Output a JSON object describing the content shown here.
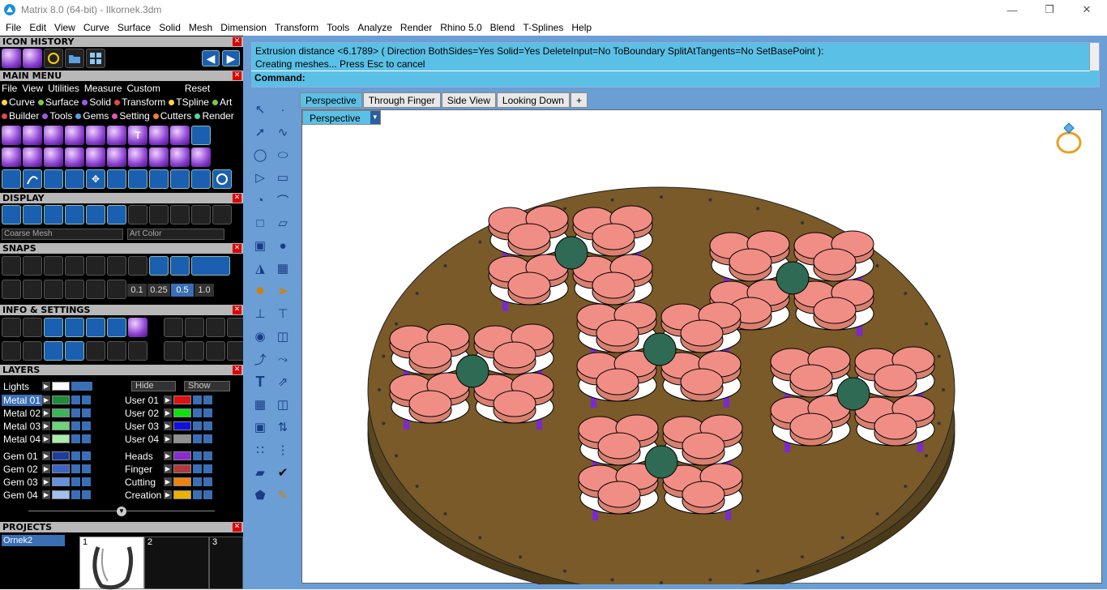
{
  "window": {
    "title": "Matrix 8.0 (64-bit) - Ilkornek.3dm"
  },
  "menu": [
    "File",
    "Edit",
    "View",
    "Curve",
    "Surface",
    "Solid",
    "Mesh",
    "Dimension",
    "Transform",
    "Tools",
    "Analyze",
    "Render",
    "Rhino 5.0",
    "Blend",
    "T-Splines",
    "Help"
  ],
  "left": {
    "icon_history": "ICON HISTORY",
    "main_menu": "MAIN MENU",
    "main_menu_items": [
      "File",
      "View",
      "Utilities",
      "Measure",
      "Custom"
    ],
    "reset": "Reset",
    "cat_row1": [
      {
        "label": "Curve",
        "color": "#ffd24a"
      },
      {
        "label": "Surface",
        "color": "#7ac943"
      },
      {
        "label": "Solid",
        "color": "#a05ae0"
      },
      {
        "label": "Transform",
        "color": "#e04a4a"
      },
      {
        "label": "TSpline",
        "color": "#ffd24a"
      },
      {
        "label": "Art",
        "color": "#7ac943"
      }
    ],
    "cat_row2": [
      {
        "label": "Builder",
        "color": "#e04a4a"
      },
      {
        "label": "Tools",
        "color": "#a05ae0"
      },
      {
        "label": "Gems",
        "color": "#5aa0e0"
      },
      {
        "label": "Setting",
        "color": "#e05ab0"
      },
      {
        "label": "Cutters",
        "color": "#f08030"
      },
      {
        "label": "Render",
        "color": "#5ad0a0"
      }
    ],
    "display": "DISPLAY",
    "display_mesh": "Coarse Mesh",
    "display_color": "Art Color",
    "snaps": "SNAPS",
    "snap_values": [
      "0.1",
      "0.25",
      "0.5",
      "1.0"
    ],
    "info_settings": "INFO & SETTINGS",
    "layers": "LAYERS",
    "lights": "Lights",
    "hide": "Hide",
    "show": "Show",
    "layers_left": [
      {
        "name": "Metal 01",
        "color": "#1e8a3a",
        "active": true
      },
      {
        "name": "Metal 02",
        "color": "#3cb45a"
      },
      {
        "name": "Metal 03",
        "color": "#6ed47a"
      },
      {
        "name": "Metal 04",
        "color": "#a8eca8"
      },
      {
        "name": "Gem 01",
        "color": "#1e3c9e"
      },
      {
        "name": "Gem 02",
        "color": "#3c64c8"
      },
      {
        "name": "Gem 03",
        "color": "#6490e0"
      },
      {
        "name": "Gem 04",
        "color": "#a0c0f0"
      }
    ],
    "layers_right": [
      {
        "name": "User 01",
        "color": "#e01010"
      },
      {
        "name": "User 02",
        "color": "#10e010"
      },
      {
        "name": "User 03",
        "color": "#1010e0"
      },
      {
        "name": "User 04",
        "color": "#909090"
      },
      {
        "name": "Heads",
        "color": "#8a2ad0"
      },
      {
        "name": "Finger",
        "color": "#b03a3a"
      },
      {
        "name": "Cutting",
        "color": "#f08010"
      },
      {
        "name": "Creation",
        "color": "#f0b000"
      }
    ],
    "projects": "PROJECTS",
    "project_name": "Ornek2",
    "project_slots": [
      "1",
      "2",
      "3"
    ]
  },
  "command": {
    "line1": "Extrusion distance <6.1789> ( Direction  BothSides=Yes  Solid=Yes  DeleteInput=No  ToBoundary  SplitAtTangents=No  SetBasePoint ):",
    "line2": "Creating meshes... Press Esc to cancel",
    "prompt": "Command:"
  },
  "tabs": [
    "Perspective",
    "Through Finger",
    "Side View",
    "Looking Down",
    "+"
  ],
  "viewport": {
    "label": "Perspective"
  }
}
